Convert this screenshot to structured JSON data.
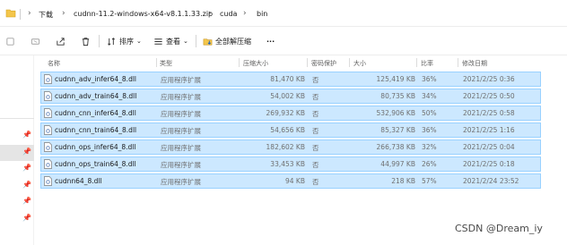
{
  "address": {
    "path": [
      "下载",
      "cudnn-11.2-windows-x64-v8.1.1.33.zip",
      "cuda",
      "bin"
    ]
  },
  "toolbar": {
    "sort_label": "排序",
    "view_label": "查看",
    "extract_all_label": "全部解压缩",
    "more_label": "···"
  },
  "columns": [
    "名称",
    "类型",
    "压缩大小",
    "密码保护",
    "大小",
    "比率",
    "修改日期"
  ],
  "files": [
    {
      "name": "cudnn_adv_infer64_8.dll",
      "type": "应用程序扩展",
      "compressed": "81,470 KB",
      "password": "否",
      "size": "125,419 KB",
      "ratio": "36%",
      "modified": "2021/2/25 0:36"
    },
    {
      "name": "cudnn_adv_train64_8.dll",
      "type": "应用程序扩展",
      "compressed": "54,002 KB",
      "password": "否",
      "size": "80,735 KB",
      "ratio": "34%",
      "modified": "2021/2/25 0:50"
    },
    {
      "name": "cudnn_cnn_infer64_8.dll",
      "type": "应用程序扩展",
      "compressed": "269,932 KB",
      "password": "否",
      "size": "532,906 KB",
      "ratio": "50%",
      "modified": "2021/2/25 0:58"
    },
    {
      "name": "cudnn_cnn_train64_8.dll",
      "type": "应用程序扩展",
      "compressed": "54,656 KB",
      "password": "否",
      "size": "85,327 KB",
      "ratio": "36%",
      "modified": "2021/2/25 1:16"
    },
    {
      "name": "cudnn_ops_infer64_8.dll",
      "type": "应用程序扩展",
      "compressed": "182,602 KB",
      "password": "否",
      "size": "266,738 KB",
      "ratio": "32%",
      "modified": "2021/2/25 0:04"
    },
    {
      "name": "cudnn_ops_train64_8.dll",
      "type": "应用程序扩展",
      "compressed": "33,453 KB",
      "password": "否",
      "size": "44,997 KB",
      "ratio": "26%",
      "modified": "2021/2/25 0:18"
    },
    {
      "name": "cudnn64_8.dll",
      "type": "应用程序扩展",
      "compressed": "94 KB",
      "password": "否",
      "size": "218 KB",
      "ratio": "57%",
      "modified": "2021/2/24 23:52"
    }
  ],
  "watermark": "CSDN @Dream_iy",
  "colors": {
    "selection_fill": "#cce8ff",
    "selection_border": "#99d1ff"
  },
  "icons": [
    "folder-icon",
    "chevron-right-icon",
    "cut-icon",
    "copy-icon",
    "share-icon",
    "delete-icon",
    "sort-icon",
    "view-icon",
    "extract-icon",
    "more-icon",
    "pin-icon",
    "dll-file-icon"
  ]
}
